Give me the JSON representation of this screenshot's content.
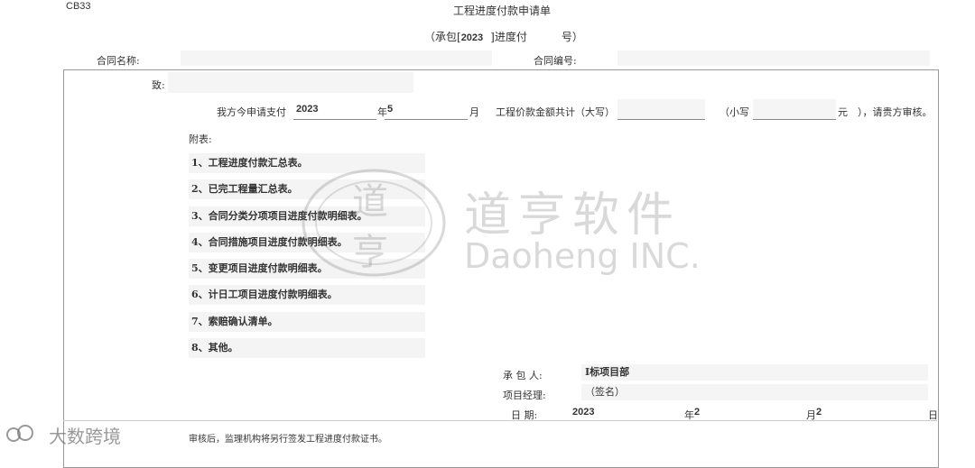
{
  "form_code": "CB33",
  "title": "工程进度付款申请单",
  "subtitle": {
    "prefix": "（承包[",
    "year": "2023",
    "middle": "]进度付",
    "suffix": "号）"
  },
  "header": {
    "contract_name_label": "合同名称:",
    "contract_no_label": "合同编号:"
  },
  "body": {
    "to_label": "致:",
    "apply_prefix": "我方今申请支付",
    "apply_year": "2023",
    "year_unit": "年",
    "apply_month": "5",
    "month_unit": "月",
    "amount_label": "工程价款金额共计（大写）",
    "small_label": "（小写",
    "yuan_unit": "元",
    "review_text": "），请贵方审核。",
    "attach_label": "附表:",
    "attachments": [
      "1、工程进度付款汇总表。",
      "2、已完工程量汇总表。",
      "3、合同分类分项项目进度付款明细表。",
      "4、合同措施项目进度付款明细表。",
      "5、变更项目进度付款明细表。",
      "6、计日工项目进度付款明细表。",
      "7、索赔确认清单。",
      "8、其他。"
    ],
    "contractor_label": "承 包 人:",
    "contractor_value": "Ⅰ标项目部",
    "pm_label": "项目经理:",
    "pm_value": "（签名）",
    "date_label": "日 期:",
    "date_year": "2023",
    "date_year_unit": "年",
    "date_month": "2",
    "date_month_unit": "月",
    "date_day": "2",
    "date_day_unit": "日"
  },
  "footer_note": "审核后，监理机构将另行签发工程进度付款证书。",
  "watermark": {
    "seal_chars": [
      "道",
      "亨"
    ],
    "cn_name": "道亨软件",
    "en_name": "Daoheng INC.",
    "corner_logo": "大数跨境"
  }
}
